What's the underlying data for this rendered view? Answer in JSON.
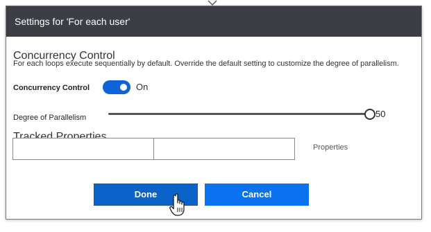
{
  "dialog": {
    "title": "Settings for 'For each user'"
  },
  "concurrency": {
    "section_title": "Concurrency Control",
    "description": "For each loops execute sequentially by default. Override the default setting to customize the degree of parallelism.",
    "toggle_label": "Concurrency Control",
    "toggle_state_text": "On",
    "toggle_on": true,
    "parallelism_label": "Degree of Parallelism",
    "parallelism_value": "50",
    "parallelism_fraction": 1.0
  },
  "tracked_properties": {
    "section_title": "Tracked Properties",
    "key_value": "",
    "value_value": "",
    "side_label": "Properties"
  },
  "buttons": {
    "done_label": "Done",
    "cancel_label": "Cancel"
  },
  "colors": {
    "header_bg": "#3b3f44",
    "accent": "#0f62d8",
    "done_bg": "#0b63c9",
    "cancel_bg": "#0a72ee"
  },
  "icons": {
    "connector": "connector-arrow-icon",
    "cursor": "hand-pointer-cursor-icon"
  }
}
